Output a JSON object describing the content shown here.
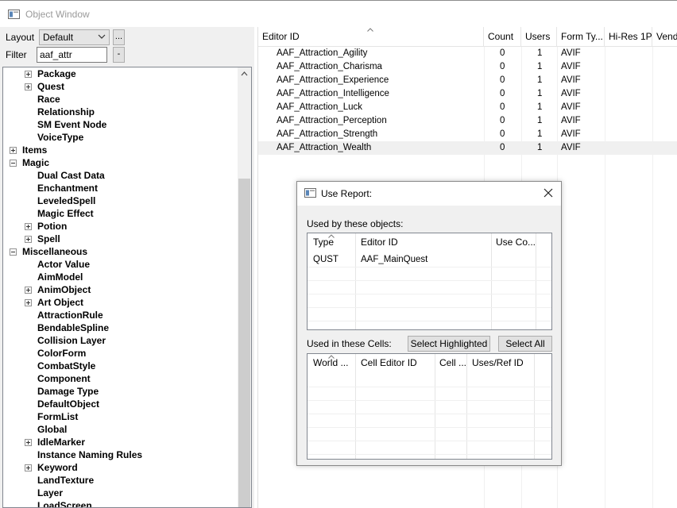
{
  "window": {
    "title": "Object Window"
  },
  "left": {
    "layout_label": "Layout",
    "layout_value": "Default",
    "layout_more": "...",
    "filter_label": "Filter",
    "filter_value": "aaf_attr",
    "filter_btn": "-",
    "tree": [
      {
        "label": "Package",
        "level": 1,
        "expander": "plus"
      },
      {
        "label": "Quest",
        "level": 1,
        "expander": "plus"
      },
      {
        "label": "Race",
        "level": 1,
        "expander": "none"
      },
      {
        "label": "Relationship",
        "level": 1,
        "expander": "none"
      },
      {
        "label": "SM Event Node",
        "level": 1,
        "expander": "none"
      },
      {
        "label": "VoiceType",
        "level": 1,
        "expander": "none"
      },
      {
        "label": "Items",
        "level": 0,
        "expander": "plus"
      },
      {
        "label": "Magic",
        "level": 0,
        "expander": "minus"
      },
      {
        "label": "Dual Cast Data",
        "level": 1,
        "expander": "none"
      },
      {
        "label": "Enchantment",
        "level": 1,
        "expander": "none"
      },
      {
        "label": "LeveledSpell",
        "level": 1,
        "expander": "none"
      },
      {
        "label": "Magic Effect",
        "level": 1,
        "expander": "none"
      },
      {
        "label": "Potion",
        "level": 1,
        "expander": "plus"
      },
      {
        "label": "Spell",
        "level": 1,
        "expander": "plus"
      },
      {
        "label": "Miscellaneous",
        "level": 0,
        "expander": "minus"
      },
      {
        "label": "Actor Value",
        "level": 1,
        "expander": "none"
      },
      {
        "label": "AimModel",
        "level": 1,
        "expander": "none"
      },
      {
        "label": "AnimObject",
        "level": 1,
        "expander": "plus"
      },
      {
        "label": "Art Object",
        "level": 1,
        "expander": "plus"
      },
      {
        "label": "AttractionRule",
        "level": 1,
        "expander": "none"
      },
      {
        "label": "BendableSpline",
        "level": 1,
        "expander": "none"
      },
      {
        "label": "Collision Layer",
        "level": 1,
        "expander": "none"
      },
      {
        "label": "ColorForm",
        "level": 1,
        "expander": "none"
      },
      {
        "label": "CombatStyle",
        "level": 1,
        "expander": "none"
      },
      {
        "label": "Component",
        "level": 1,
        "expander": "none"
      },
      {
        "label": "Damage Type",
        "level": 1,
        "expander": "none"
      },
      {
        "label": "DefaultObject",
        "level": 1,
        "expander": "none"
      },
      {
        "label": "FormList",
        "level": 1,
        "expander": "none"
      },
      {
        "label": "Global",
        "level": 1,
        "expander": "none"
      },
      {
        "label": "IdleMarker",
        "level": 1,
        "expander": "plus"
      },
      {
        "label": "Instance Naming Rules",
        "level": 1,
        "expander": "none"
      },
      {
        "label": "Keyword",
        "level": 1,
        "expander": "plus"
      },
      {
        "label": "LandTexture",
        "level": 1,
        "expander": "none"
      },
      {
        "label": "Layer",
        "level": 1,
        "expander": "none"
      },
      {
        "label": "LoadScreen",
        "level": 1,
        "expander": "none"
      }
    ]
  },
  "list": {
    "headers": [
      "Editor ID",
      "Count",
      "Users",
      "Form Ty...",
      "Hi-Res 1P",
      "Vend"
    ],
    "rows": [
      [
        "AAF_Attraction_Agility",
        "0",
        "1",
        "AVIF"
      ],
      [
        "AAF_Attraction_Charisma",
        "0",
        "1",
        "AVIF"
      ],
      [
        "AAF_Attraction_Experience",
        "0",
        "1",
        "AVIF"
      ],
      [
        "AAF_Attraction_Intelligence",
        "0",
        "1",
        "AVIF"
      ],
      [
        "AAF_Attraction_Luck",
        "0",
        "1",
        "AVIF"
      ],
      [
        "AAF_Attraction_Perception",
        "0",
        "1",
        "AVIF"
      ],
      [
        "AAF_Attraction_Strength",
        "0",
        "1",
        "AVIF"
      ],
      [
        "AAF_Attraction_Wealth",
        "0",
        "1",
        "AVIF"
      ]
    ],
    "selected_index": 7
  },
  "dialog": {
    "title": "Use Report:",
    "used_by_label": "Used by these objects:",
    "used_by_headers": [
      "Type",
      "Editor ID",
      "Use Co..."
    ],
    "used_by_rows": [
      [
        "QUST",
        "AAF_MainQuest",
        ""
      ]
    ],
    "cells_label": "Used in these Cells:",
    "select_highlighted": "Select Highlighted",
    "select_all": "Select All",
    "cells_headers": [
      "World ...",
      "Cell Editor ID",
      "Cell ...",
      "Uses/Ref ID"
    ]
  }
}
